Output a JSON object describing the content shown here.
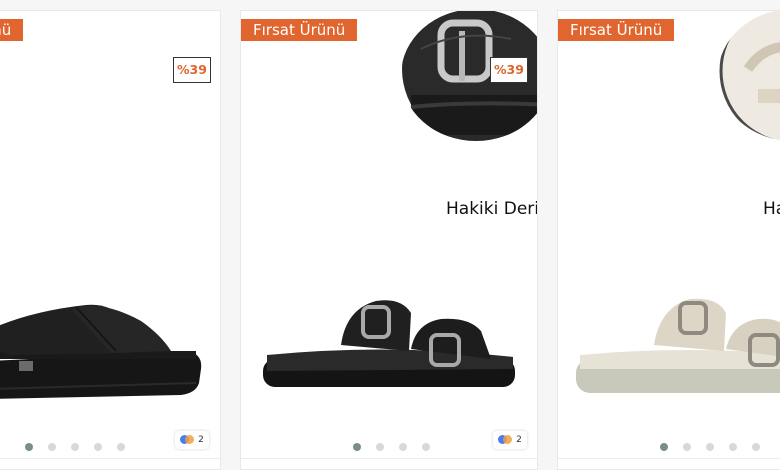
{
  "products": [
    {
      "badge": "Fırsat Ürünü",
      "discount": "%39",
      "color_count": "2",
      "image_dots": 5,
      "active_dot": 0,
      "shoe_color": "#1c1c1c"
    },
    {
      "badge": "Fırsat Ürünü",
      "discount": "%39",
      "feature": "Hakiki Deri",
      "color_count": "2",
      "image_dots": 4,
      "active_dot": 0,
      "shoe_color": "#1f1f1f"
    },
    {
      "badge": "Fırsat Ürünü",
      "feature": "Hakiki Deri",
      "image_dots": 5,
      "active_dot": 0,
      "shoe_color": "#d8d0bf"
    }
  ],
  "colors": {
    "badge_bg": "#e0652f",
    "dot_active": "#7b8d8b",
    "dot_inactive": "#d8d8d8"
  }
}
